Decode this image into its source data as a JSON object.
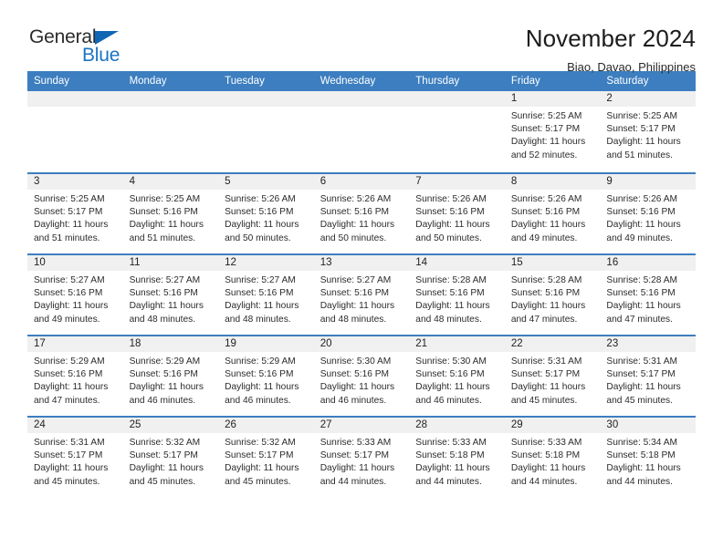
{
  "brand": {
    "word1": "General",
    "word2": "Blue",
    "triangle_color": "#1166b4",
    "blue_text_color": "#1a73c4"
  },
  "header": {
    "title": "November 2024",
    "subtitle": "Biao, Davao, Philippines"
  },
  "theme": {
    "header_bar": "#3c7ebf",
    "cell_head_bg": "#f0f0f0",
    "cell_bg": "#ffffff"
  },
  "weekdays": [
    "Sunday",
    "Monday",
    "Tuesday",
    "Wednesday",
    "Thursday",
    "Friday",
    "Saturday"
  ],
  "weeks": [
    [
      {
        "day": "",
        "sunrise": "",
        "sunset": "",
        "daylight1": "",
        "daylight2": ""
      },
      {
        "day": "",
        "sunrise": "",
        "sunset": "",
        "daylight1": "",
        "daylight2": ""
      },
      {
        "day": "",
        "sunrise": "",
        "sunset": "",
        "daylight1": "",
        "daylight2": ""
      },
      {
        "day": "",
        "sunrise": "",
        "sunset": "",
        "daylight1": "",
        "daylight2": ""
      },
      {
        "day": "",
        "sunrise": "",
        "sunset": "",
        "daylight1": "",
        "daylight2": ""
      },
      {
        "day": "1",
        "sunrise": "Sunrise: 5:25 AM",
        "sunset": "Sunset: 5:17 PM",
        "daylight1": "Daylight: 11 hours",
        "daylight2": "and 52 minutes."
      },
      {
        "day": "2",
        "sunrise": "Sunrise: 5:25 AM",
        "sunset": "Sunset: 5:17 PM",
        "daylight1": "Daylight: 11 hours",
        "daylight2": "and 51 minutes."
      }
    ],
    [
      {
        "day": "3",
        "sunrise": "Sunrise: 5:25 AM",
        "sunset": "Sunset: 5:17 PM",
        "daylight1": "Daylight: 11 hours",
        "daylight2": "and 51 minutes."
      },
      {
        "day": "4",
        "sunrise": "Sunrise: 5:25 AM",
        "sunset": "Sunset: 5:16 PM",
        "daylight1": "Daylight: 11 hours",
        "daylight2": "and 51 minutes."
      },
      {
        "day": "5",
        "sunrise": "Sunrise: 5:26 AM",
        "sunset": "Sunset: 5:16 PM",
        "daylight1": "Daylight: 11 hours",
        "daylight2": "and 50 minutes."
      },
      {
        "day": "6",
        "sunrise": "Sunrise: 5:26 AM",
        "sunset": "Sunset: 5:16 PM",
        "daylight1": "Daylight: 11 hours",
        "daylight2": "and 50 minutes."
      },
      {
        "day": "7",
        "sunrise": "Sunrise: 5:26 AM",
        "sunset": "Sunset: 5:16 PM",
        "daylight1": "Daylight: 11 hours",
        "daylight2": "and 50 minutes."
      },
      {
        "day": "8",
        "sunrise": "Sunrise: 5:26 AM",
        "sunset": "Sunset: 5:16 PM",
        "daylight1": "Daylight: 11 hours",
        "daylight2": "and 49 minutes."
      },
      {
        "day": "9",
        "sunrise": "Sunrise: 5:26 AM",
        "sunset": "Sunset: 5:16 PM",
        "daylight1": "Daylight: 11 hours",
        "daylight2": "and 49 minutes."
      }
    ],
    [
      {
        "day": "10",
        "sunrise": "Sunrise: 5:27 AM",
        "sunset": "Sunset: 5:16 PM",
        "daylight1": "Daylight: 11 hours",
        "daylight2": "and 49 minutes."
      },
      {
        "day": "11",
        "sunrise": "Sunrise: 5:27 AM",
        "sunset": "Sunset: 5:16 PM",
        "daylight1": "Daylight: 11 hours",
        "daylight2": "and 48 minutes."
      },
      {
        "day": "12",
        "sunrise": "Sunrise: 5:27 AM",
        "sunset": "Sunset: 5:16 PM",
        "daylight1": "Daylight: 11 hours",
        "daylight2": "and 48 minutes."
      },
      {
        "day": "13",
        "sunrise": "Sunrise: 5:27 AM",
        "sunset": "Sunset: 5:16 PM",
        "daylight1": "Daylight: 11 hours",
        "daylight2": "and 48 minutes."
      },
      {
        "day": "14",
        "sunrise": "Sunrise: 5:28 AM",
        "sunset": "Sunset: 5:16 PM",
        "daylight1": "Daylight: 11 hours",
        "daylight2": "and 48 minutes."
      },
      {
        "day": "15",
        "sunrise": "Sunrise: 5:28 AM",
        "sunset": "Sunset: 5:16 PM",
        "daylight1": "Daylight: 11 hours",
        "daylight2": "and 47 minutes."
      },
      {
        "day": "16",
        "sunrise": "Sunrise: 5:28 AM",
        "sunset": "Sunset: 5:16 PM",
        "daylight1": "Daylight: 11 hours",
        "daylight2": "and 47 minutes."
      }
    ],
    [
      {
        "day": "17",
        "sunrise": "Sunrise: 5:29 AM",
        "sunset": "Sunset: 5:16 PM",
        "daylight1": "Daylight: 11 hours",
        "daylight2": "and 47 minutes."
      },
      {
        "day": "18",
        "sunrise": "Sunrise: 5:29 AM",
        "sunset": "Sunset: 5:16 PM",
        "daylight1": "Daylight: 11 hours",
        "daylight2": "and 46 minutes."
      },
      {
        "day": "19",
        "sunrise": "Sunrise: 5:29 AM",
        "sunset": "Sunset: 5:16 PM",
        "daylight1": "Daylight: 11 hours",
        "daylight2": "and 46 minutes."
      },
      {
        "day": "20",
        "sunrise": "Sunrise: 5:30 AM",
        "sunset": "Sunset: 5:16 PM",
        "daylight1": "Daylight: 11 hours",
        "daylight2": "and 46 minutes."
      },
      {
        "day": "21",
        "sunrise": "Sunrise: 5:30 AM",
        "sunset": "Sunset: 5:16 PM",
        "daylight1": "Daylight: 11 hours",
        "daylight2": "and 46 minutes."
      },
      {
        "day": "22",
        "sunrise": "Sunrise: 5:31 AM",
        "sunset": "Sunset: 5:17 PM",
        "daylight1": "Daylight: 11 hours",
        "daylight2": "and 45 minutes."
      },
      {
        "day": "23",
        "sunrise": "Sunrise: 5:31 AM",
        "sunset": "Sunset: 5:17 PM",
        "daylight1": "Daylight: 11 hours",
        "daylight2": "and 45 minutes."
      }
    ],
    [
      {
        "day": "24",
        "sunrise": "Sunrise: 5:31 AM",
        "sunset": "Sunset: 5:17 PM",
        "daylight1": "Daylight: 11 hours",
        "daylight2": "and 45 minutes."
      },
      {
        "day": "25",
        "sunrise": "Sunrise: 5:32 AM",
        "sunset": "Sunset: 5:17 PM",
        "daylight1": "Daylight: 11 hours",
        "daylight2": "and 45 minutes."
      },
      {
        "day": "26",
        "sunrise": "Sunrise: 5:32 AM",
        "sunset": "Sunset: 5:17 PM",
        "daylight1": "Daylight: 11 hours",
        "daylight2": "and 45 minutes."
      },
      {
        "day": "27",
        "sunrise": "Sunrise: 5:33 AM",
        "sunset": "Sunset: 5:17 PM",
        "daylight1": "Daylight: 11 hours",
        "daylight2": "and 44 minutes."
      },
      {
        "day": "28",
        "sunrise": "Sunrise: 5:33 AM",
        "sunset": "Sunset: 5:18 PM",
        "daylight1": "Daylight: 11 hours",
        "daylight2": "and 44 minutes."
      },
      {
        "day": "29",
        "sunrise": "Sunrise: 5:33 AM",
        "sunset": "Sunset: 5:18 PM",
        "daylight1": "Daylight: 11 hours",
        "daylight2": "and 44 minutes."
      },
      {
        "day": "30",
        "sunrise": "Sunrise: 5:34 AM",
        "sunset": "Sunset: 5:18 PM",
        "daylight1": "Daylight: 11 hours",
        "daylight2": "and 44 minutes."
      }
    ]
  ]
}
